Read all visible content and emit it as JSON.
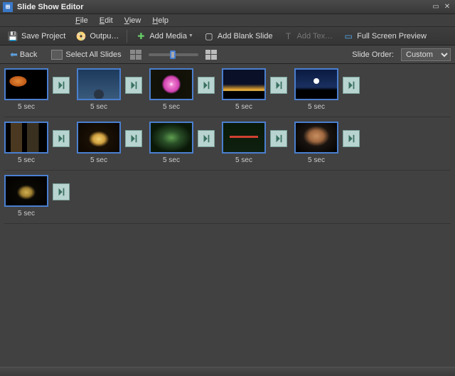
{
  "window": {
    "title": "Slide Show Editor",
    "app_icon_label": "pse"
  },
  "menu": {
    "file": "File",
    "edit": "Edit",
    "view": "View",
    "help": "Help"
  },
  "toolbar": {
    "save_project": "Save Project",
    "output": "Outpu…",
    "add_media": "Add Media",
    "add_blank_slide": "Add Blank Slide",
    "add_text": "Add Tex…",
    "full_screen_preview": "Full Screen Preview"
  },
  "secondbar": {
    "back": "Back",
    "select_all_slides": "Select All Slides",
    "slide_order_label": "Slide Order:",
    "slide_order_value": "Custom"
  },
  "slides": {
    "rows": [
      [
        {
          "duration": "5 sec",
          "paint": "paint-silhouette"
        },
        {
          "duration": "5 sec",
          "paint": "paint-birds"
        },
        {
          "duration": "5 sec",
          "paint": "paint-flower"
        },
        {
          "duration": "5 sec",
          "paint": "paint-sunset"
        },
        {
          "duration": "5 sec",
          "paint": "paint-moon"
        }
      ],
      [
        {
          "duration": "5 sec",
          "paint": "paint-gallery"
        },
        {
          "duration": "5 sec",
          "paint": "paint-dome"
        },
        {
          "duration": "5 sec",
          "paint": "paint-leaves"
        },
        {
          "duration": "5 sec",
          "paint": "paint-dragonfly"
        },
        {
          "duration": "5 sec",
          "paint": "paint-portrait"
        }
      ],
      [
        {
          "duration": "5 sec",
          "paint": "paint-bell"
        }
      ]
    ]
  }
}
